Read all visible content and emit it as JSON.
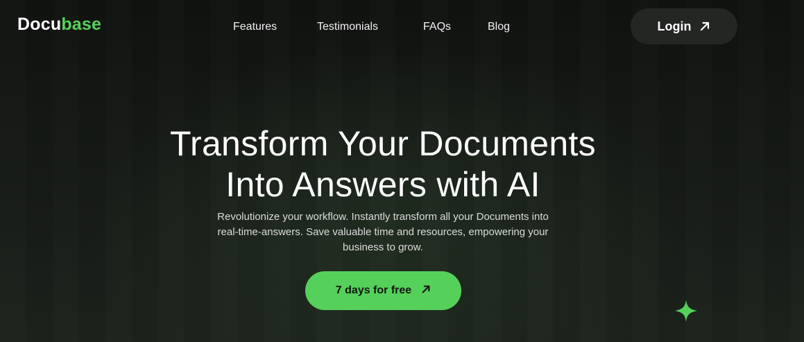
{
  "brand": {
    "name_part1": "Docu",
    "name_part2": "base",
    "accent_color": "#56d15a"
  },
  "nav": {
    "items": [
      {
        "label": "Features"
      },
      {
        "label": "Testimonials"
      },
      {
        "label": "FAQs"
      },
      {
        "label": "Blog"
      }
    ]
  },
  "header": {
    "login_label": "Login",
    "login_icon": "arrow-up-right-icon"
  },
  "hero": {
    "title_line1": "Transform Your Documents",
    "title_line2": "Into Answers with AI",
    "subtitle": "Revolutionize your workflow. Instantly transform all your Documents into real-time-answers. Save valuable time and resources, empowering your business to grow.",
    "cta_label": "7 days for free",
    "cta_icon": "arrow-up-right-icon",
    "cta_color": "#55d05b"
  },
  "decor": {
    "sparkle_icon": "sparkle-star-icon"
  }
}
